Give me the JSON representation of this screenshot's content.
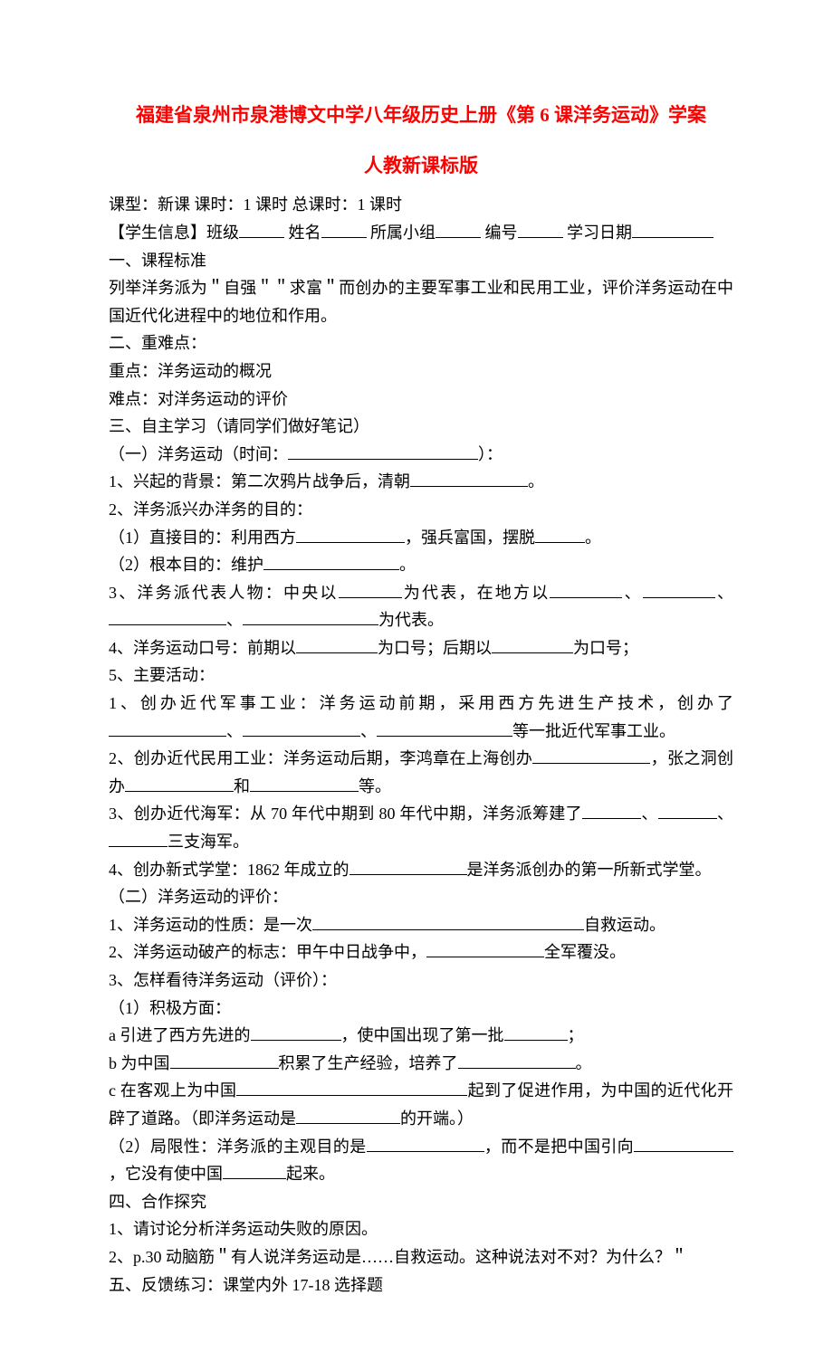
{
  "title1": "福建省泉州市泉港博文中学八年级历史上册《第 6 课洋务运动》学案",
  "title2": "人教新课标版",
  "meta_line": "课型：新课  课时：1 课时  总课时：1 课时",
  "student_info": {
    "prefix": "【学生信息】班级",
    "name_label": "  姓名",
    "group_label": "所属小组",
    "number_label": "编号",
    "date_label": "学习日期"
  },
  "sec1_title": "一、课程标准",
  "sec1_body": "列举洋务派为＂自强＂＂求富＂而创办的主要军事工业和民用工业，评价洋务运动在中国近代化进程中的地位和作用。",
  "sec2_title": "二、重难点：",
  "sec2_point1": "重点：洋务运动的概况",
  "sec2_point2": "难点：对洋务运动的评价",
  "sec3_title": "三、自主学习（请同学们做好笔记）",
  "sec3_sub1": {
    "prefix": "（一）洋务运动（时间：",
    "suffix": "）："
  },
  "s3_1": {
    "prefix": "1、兴起的背景：第二次鸦片战争后，清朝",
    "suffix": "。"
  },
  "s3_2": "2、洋务派兴办洋务的目的：",
  "s3_2_1": {
    "prefix": "（1）直接目的：利用西方",
    "mid": "，强兵富国，摆脱",
    "suffix": "。"
  },
  "s3_2_2": {
    "prefix": "（2）根本目的：维护",
    "suffix": "。"
  },
  "s3_3": {
    "prefix": "3、洋务派代表人物：中央以",
    "mid1": "为代表，在地方以",
    "sep": "、",
    "suffix": "为代表。"
  },
  "s3_4": {
    "prefix": "4、洋务运动口号：前期以",
    "mid": "为口号；后期以",
    "suffix": "为口号；"
  },
  "s3_5": "5、主要活动：",
  "s3_5_1": {
    "prefix": "1、创办近代军事工业：洋务运动前期，采用西方先进生产技术，创办了",
    "sep": "、",
    "suffix": "等一批近代军事工业。"
  },
  "s3_5_2": {
    "prefix": "2、创办近代民用工业：洋务运动后期，李鸿章在上海创办",
    "mid1": "，张之洞创办",
    "mid2": "和",
    "suffix": "等。"
  },
  "s3_5_3": {
    "prefix": "3、创办近代海军：从 70 年代中期到 80 年代中期，洋务派筹建了",
    "sep": "、",
    "suffix": "三支海军。"
  },
  "s3_5_4": {
    "prefix": "4、创办新式学堂：1862 年成立的",
    "suffix": "是洋务派创办的第一所新式学堂。"
  },
  "sec3_sub2": "（二）洋务运动的评价：",
  "e1": {
    "prefix": "1、洋务运动的性质：是一次",
    "suffix": "自救运动。"
  },
  "e2": {
    "prefix": "2、洋务运动破产的标志：甲午中日战争中，",
    "suffix": "全军覆没。"
  },
  "e3": "3、怎样看待洋务运动（评价）：",
  "e3_1": "（1）积极方面：",
  "e3_1a": {
    "prefix": "a 引进了西方先进的",
    "mid": "，使中国出现了第一批",
    "suffix": "；"
  },
  "e3_1b": {
    "prefix": "b 为中国",
    "mid": "积累了生产经验，培养了",
    "suffix": "。"
  },
  "e3_1c": {
    "prefix": "c 在客观上为中国",
    "mid1": "起到了促进作用，为中国的近代化开辟了道路。（即洋务运动是",
    "suffix": "的开端。）"
  },
  "e3_2": {
    "prefix": "（2）局限性：洋务派的主观目的是",
    "mid1": "，而不是把中国引向",
    "mid2": "，它没有使中国",
    "suffix": "起来。"
  },
  "sec4_title": "四、合作探究",
  "sec4_1": "1、请讨论分析洋务运动失败的原因。",
  "sec4_2": "2、p.30 动脑筋＂有人说洋务运动是……自救运动。这种说法对不对？为什么？＂",
  "sec5_title": "五、反馈练习：课堂内外 17-18 选择题"
}
